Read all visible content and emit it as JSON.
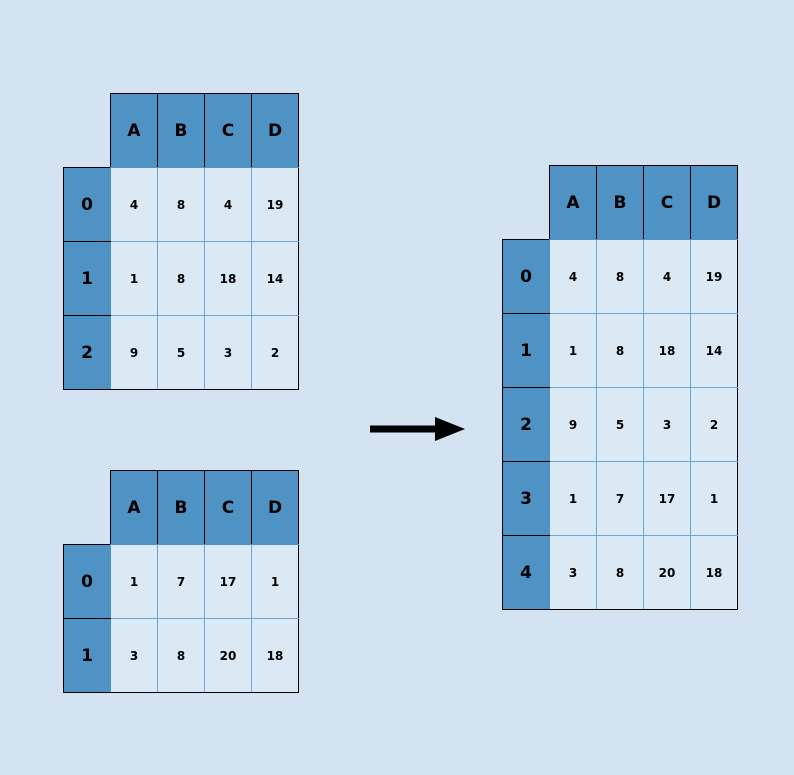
{
  "tables": {
    "top_left": {
      "columns": [
        "A",
        "B",
        "C",
        "D"
      ],
      "index": [
        "0",
        "1",
        "2"
      ],
      "rows": [
        [
          "4",
          "8",
          "4",
          "19"
        ],
        [
          "1",
          "8",
          "18",
          "14"
        ],
        [
          "9",
          "5",
          "3",
          "2"
        ]
      ]
    },
    "bottom_left": {
      "columns": [
        "A",
        "B",
        "C",
        "D"
      ],
      "index": [
        "0",
        "1"
      ],
      "rows": [
        [
          "1",
          "7",
          "17",
          "1"
        ],
        [
          "3",
          "8",
          "20",
          "18"
        ]
      ]
    },
    "right": {
      "columns": [
        "A",
        "B",
        "C",
        "D"
      ],
      "index": [
        "0",
        "1",
        "2",
        "3",
        "4"
      ],
      "rows": [
        [
          "4",
          "8",
          "4",
          "19"
        ],
        [
          "1",
          "8",
          "18",
          "14"
        ],
        [
          "9",
          "5",
          "3",
          "2"
        ],
        [
          "1",
          "7",
          "17",
          "1"
        ],
        [
          "3",
          "8",
          "20",
          "18"
        ]
      ]
    }
  },
  "colors": {
    "background": "#d3e3f1",
    "header": "#4f93c5",
    "cell": "#dbe9f5"
  }
}
